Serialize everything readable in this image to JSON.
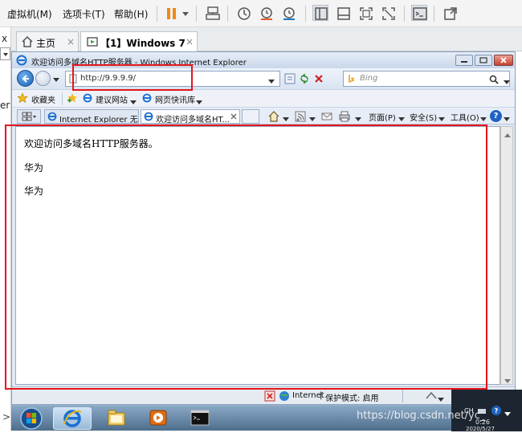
{
  "vmware": {
    "menus": [
      "虚拟机(M)",
      "选项卡(T)",
      "帮助(H)"
    ],
    "tool_icons": [
      "pause-icon",
      "dropdown-arrow-icon",
      "send-keys-icon",
      "snapshot-icon",
      "revert-snapshot-icon",
      "manage-snapshots-icon",
      "sidebar-view-icon",
      "thumbnail-view-icon",
      "fullscreen-icon",
      "unity-icon",
      "console-view-icon",
      "stretch-icon"
    ],
    "accent_pause": "#f08a18"
  },
  "left_strip": {
    "close_glyph": "x",
    "cut_text": "er",
    "arrow_glyph": ">"
  },
  "vm_tabs": [
    {
      "label": "主页",
      "icon": "home-icon",
      "close": "×"
    },
    {
      "label": "【1】Windows 7",
      "icon": "vm-play-icon",
      "close": "×"
    }
  ],
  "ie": {
    "title": "欢迎访问多域名HTTP服务器 - Windows Internet Explorer",
    "address": "http://9.9.9.9/",
    "search_placeholder": "Bing",
    "favorites": {
      "label": "收藏夹",
      "suggested_sites": "建议网站",
      "web_slice_gallery": "网页快讯库"
    },
    "page_tabs": [
      {
        "label": "Internet Explorer 无..."
      },
      {
        "label": "欢迎访问多域名HT..."
      }
    ],
    "command_bar": {
      "page": "页面(P)",
      "safety": "安全(S)",
      "tools": "工具(O)"
    },
    "content": {
      "lines": [
        "欢迎访问多域名HTTP服务器。",
        "华为",
        "华为"
      ]
    },
    "status": {
      "zone": "Internet",
      "protected_mode": "保护模式: 启用"
    }
  },
  "taskbar": {
    "buttons": [
      "start-orb-icon",
      "internet-explorer-icon",
      "file-explorer-icon",
      "media-player-icon",
      "command-prompt-icon"
    ],
    "language": "CH",
    "time": "0:26",
    "date": "2020/5/27"
  },
  "watermark": "https://blog.csdn.net/yc_"
}
